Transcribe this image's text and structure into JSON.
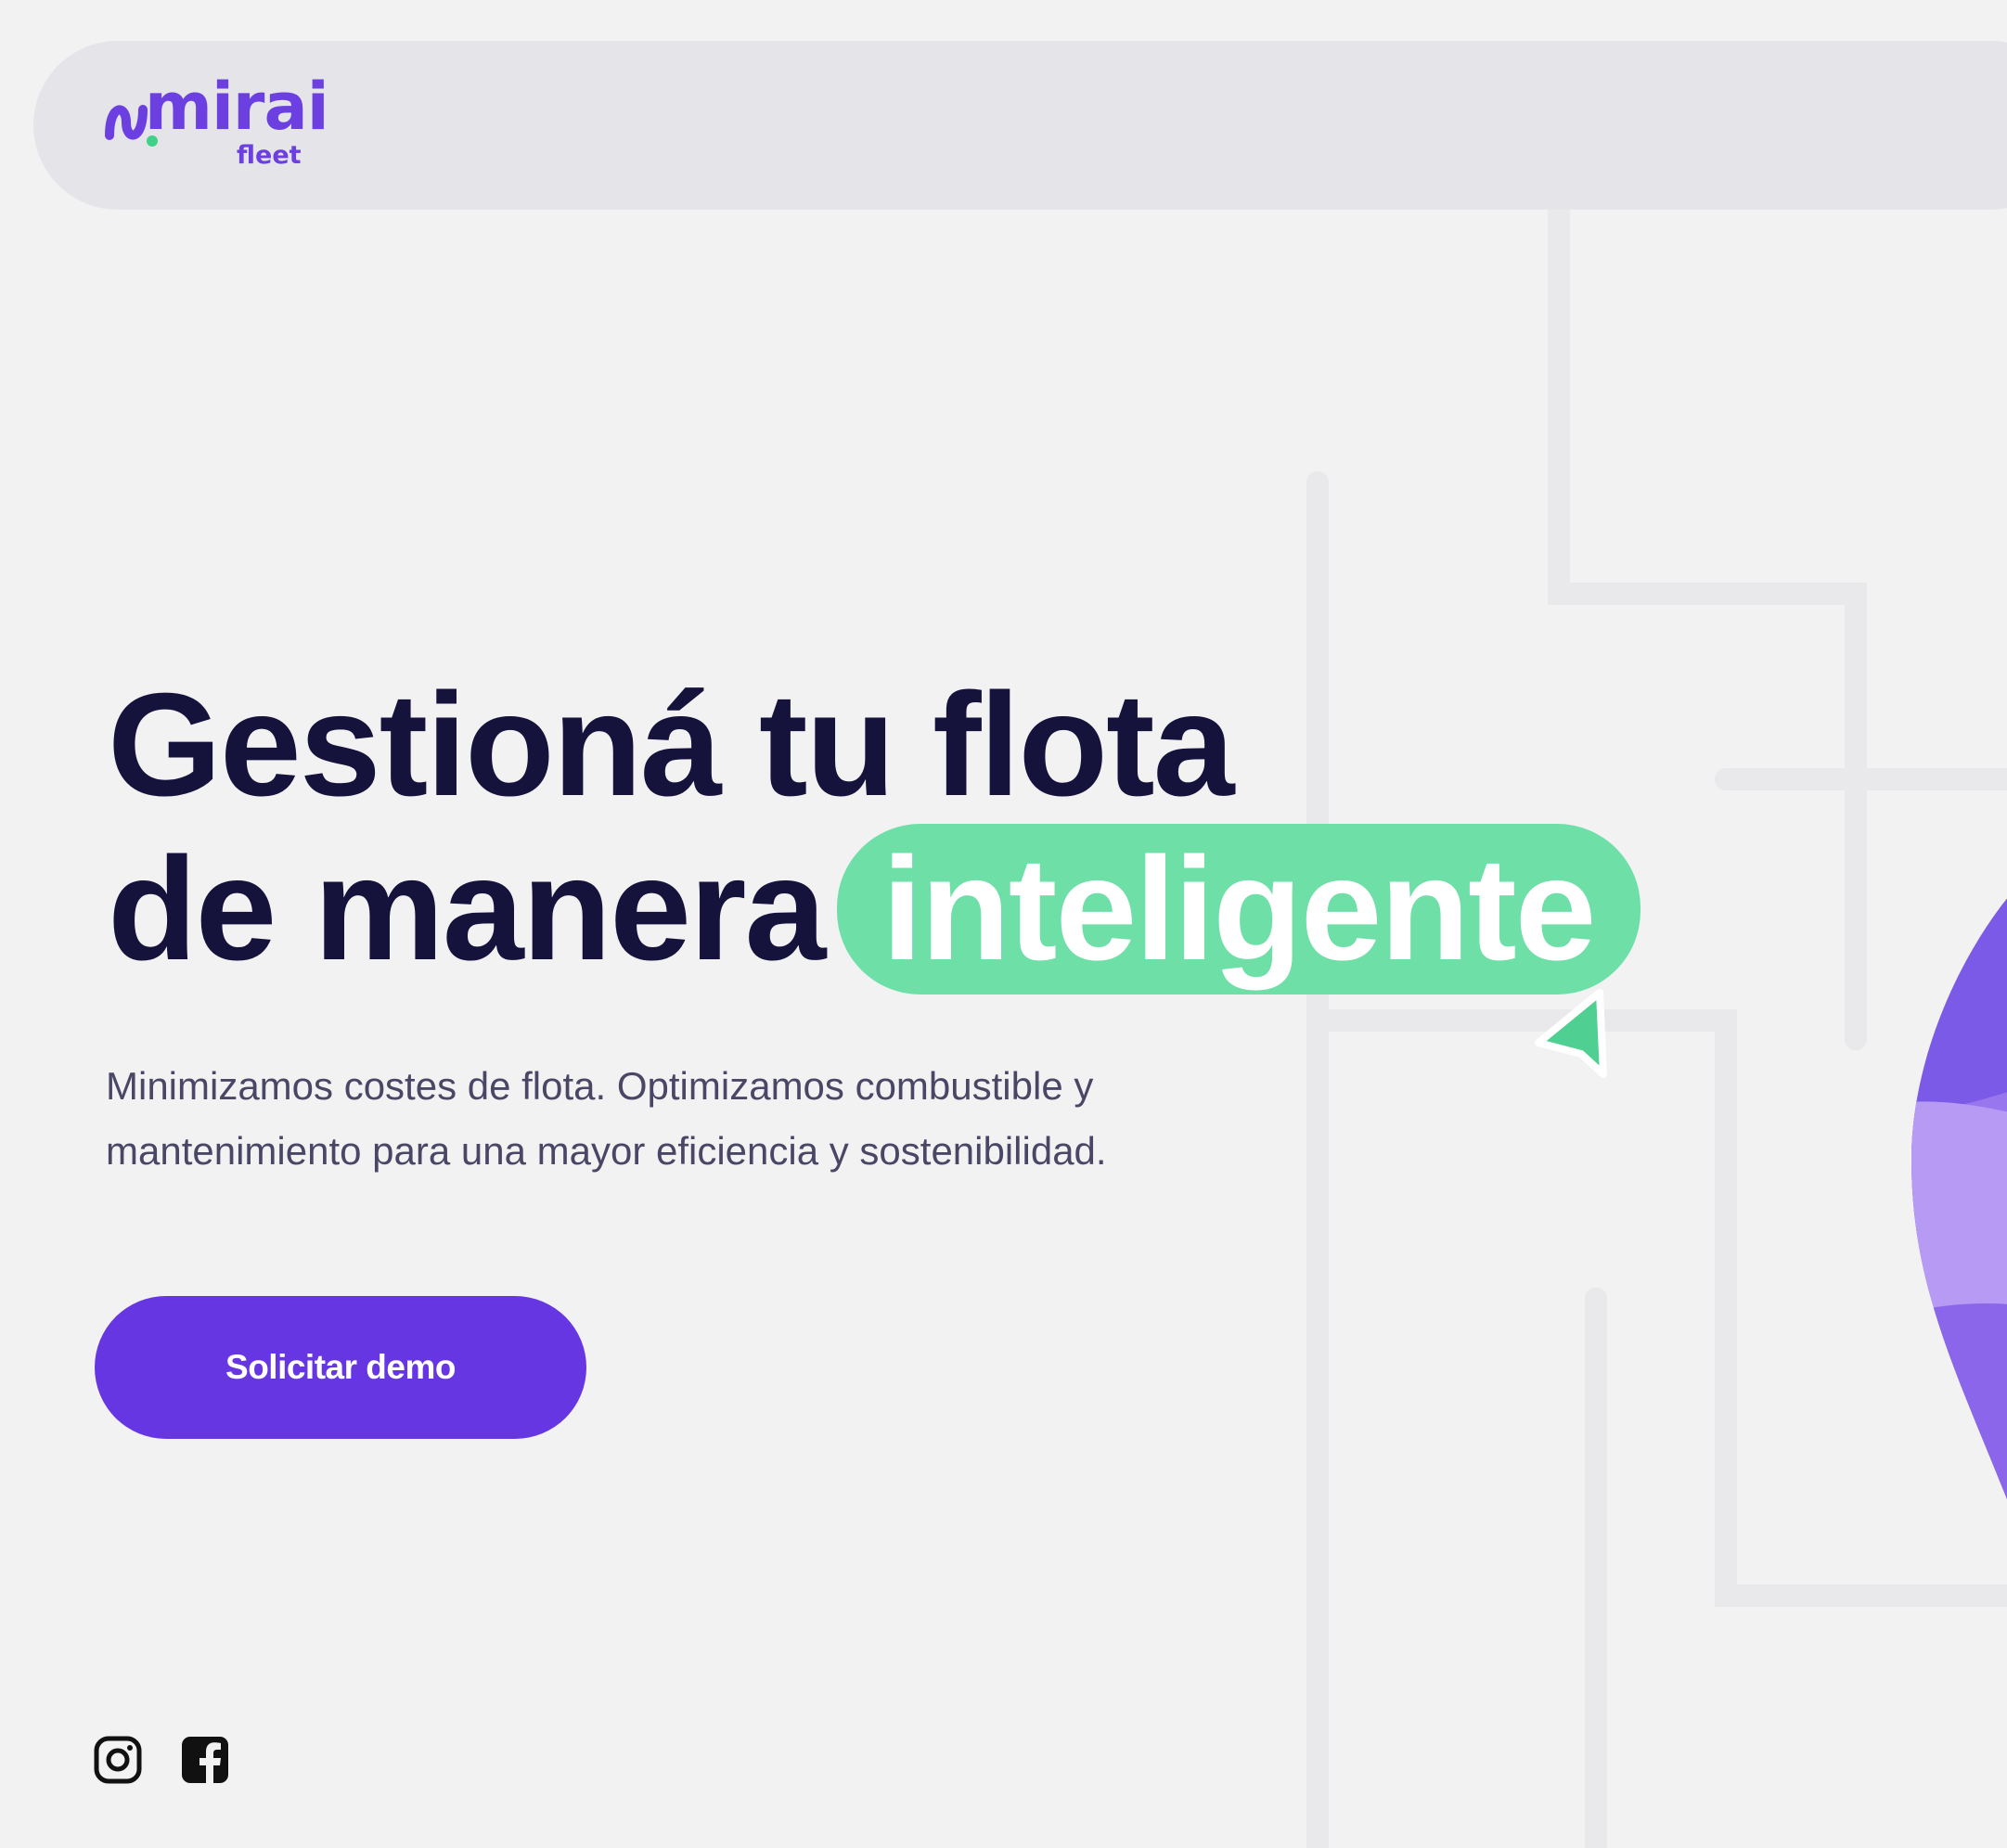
{
  "header": {
    "logo_text": "mirai",
    "logo_subtext": "fleet"
  },
  "hero": {
    "headline_line1": "Gestioná tu flota",
    "headline_line2_prefix": "de manera",
    "headline_highlight": "inteligente",
    "subtext_line1": "Minimizamos costes de flota. Optimizamos combustible y",
    "subtext_line2": "mantenimiento para una mayor eficiencia y sostenibilidad.",
    "cta_label": "Solicitar demo"
  },
  "social": {
    "icons": [
      "instagram-icon",
      "facebook-icon"
    ]
  },
  "colors": {
    "brand_purple": "#6636e2",
    "accent_green": "#6ddfa7",
    "headline_text": "#15123c",
    "body_text": "#4a4766",
    "background": "#f2f2f3",
    "navbar": "#e4e4e9"
  }
}
